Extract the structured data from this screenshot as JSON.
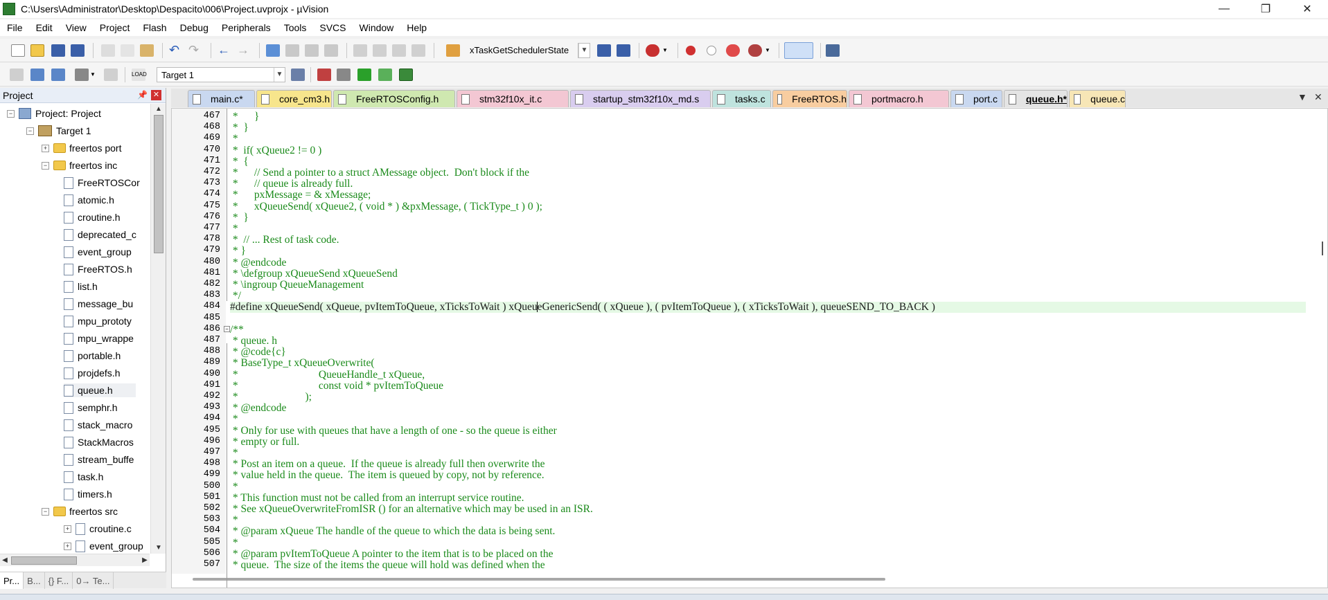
{
  "window": {
    "title": "C:\\Users\\Administrator\\Desktop\\Despacito\\006\\Project.uvprojx - µVision"
  },
  "menu": [
    "File",
    "Edit",
    "View",
    "Project",
    "Flash",
    "Debug",
    "Peripherals",
    "Tools",
    "SVCS",
    "Window",
    "Help"
  ],
  "toolbar": {
    "function_combo": "xTaskGetSchedulerState",
    "target_combo": "Target 1"
  },
  "project_panel": {
    "title": "Project",
    "tree": [
      {
        "label": "Project: Project",
        "level": 0,
        "kind": "project",
        "expanded": true
      },
      {
        "label": "Target 1",
        "level": 1,
        "kind": "target",
        "expanded": true
      },
      {
        "label": "freertos port",
        "level": 2,
        "kind": "folder",
        "expanded": false
      },
      {
        "label": "freertos inc",
        "level": 2,
        "kind": "folder",
        "expanded": true
      },
      {
        "label": "FreeRTOSCor",
        "level": 3,
        "kind": "file"
      },
      {
        "label": "atomic.h",
        "level": 3,
        "kind": "file"
      },
      {
        "label": "croutine.h",
        "level": 3,
        "kind": "file"
      },
      {
        "label": "deprecated_c",
        "level": 3,
        "kind": "file"
      },
      {
        "label": "event_group",
        "level": 3,
        "kind": "file"
      },
      {
        "label": "FreeRTOS.h",
        "level": 3,
        "kind": "file"
      },
      {
        "label": "list.h",
        "level": 3,
        "kind": "file"
      },
      {
        "label": "message_bu",
        "level": 3,
        "kind": "file"
      },
      {
        "label": "mpu_prototy",
        "level": 3,
        "kind": "file"
      },
      {
        "label": "mpu_wrappe",
        "level": 3,
        "kind": "file"
      },
      {
        "label": "portable.h",
        "level": 3,
        "kind": "file"
      },
      {
        "label": "projdefs.h",
        "level": 3,
        "kind": "file"
      },
      {
        "label": "queue.h",
        "level": 3,
        "kind": "file",
        "selected": true
      },
      {
        "label": "semphr.h",
        "level": 3,
        "kind": "file"
      },
      {
        "label": "stack_macro",
        "level": 3,
        "kind": "file"
      },
      {
        "label": "StackMacros",
        "level": 3,
        "kind": "file"
      },
      {
        "label": "stream_buffe",
        "level": 3,
        "kind": "file"
      },
      {
        "label": "task.h",
        "level": 3,
        "kind": "file"
      },
      {
        "label": "timers.h",
        "level": 3,
        "kind": "file"
      },
      {
        "label": "freertos src",
        "level": 2,
        "kind": "folder",
        "expanded": true
      },
      {
        "label": "croutine.c",
        "level": 3,
        "kind": "file-exp"
      },
      {
        "label": "event_group",
        "level": 3,
        "kind": "file-exp"
      }
    ],
    "bottom_tabs": [
      "Pr...",
      "B...",
      "{} F...",
      "0→ Te..."
    ]
  },
  "editor_tabs": [
    {
      "label": "main.c*",
      "color": "#c9d8f0"
    },
    {
      "label": "core_cm3.h",
      "color": "#f7e58c"
    },
    {
      "label": "FreeRTOSConfig.h",
      "color": "#cfe8b0"
    },
    {
      "label": "stm32f10x_it.c",
      "color": "#f3c7d3"
    },
    {
      "label": "startup_stm32f10x_md.s",
      "color": "#d9cdef"
    },
    {
      "label": "tasks.c",
      "color": "#bfe3de"
    },
    {
      "label": "FreeRTOS.h",
      "color": "#f8cda0"
    },
    {
      "label": "portmacro.h",
      "color": "#f3c7d3"
    },
    {
      "label": "port.c",
      "color": "#c9d8f0"
    },
    {
      "label": "queue.h*",
      "color": "#e4e4e4",
      "active": true
    },
    {
      "label": "queue.c",
      "color": "#f7e6b6"
    }
  ],
  "code": [
    {
      "n": "467",
      "t": " *      }"
    },
    {
      "n": "468",
      "t": " *  }"
    },
    {
      "n": "469",
      "t": " *"
    },
    {
      "n": "470",
      "t": " *  if( xQueue2 != 0 )"
    },
    {
      "n": "471",
      "t": " *  {"
    },
    {
      "n": "472",
      "t": " *      // Send a pointer to a struct AMessage object.  Don't block if the"
    },
    {
      "n": "473",
      "t": " *      // queue is already full."
    },
    {
      "n": "474",
      "t": " *      pxMessage = & xMessage;"
    },
    {
      "n": "475",
      "t": " *      xQueueSend( xQueue2, ( void * ) &pxMessage, ( TickType_t ) 0 );"
    },
    {
      "n": "476",
      "t": " *  }"
    },
    {
      "n": "477",
      "t": " *"
    },
    {
      "n": "478",
      "t": " *  // ... Rest of task code."
    },
    {
      "n": "479",
      "t": " * }"
    },
    {
      "n": "480",
      "t": " * @endcode"
    },
    {
      "n": "481",
      "t": " * \\defgroup xQueueSend xQueueSend"
    },
    {
      "n": "482",
      "t": " * \\ingroup QueueManagement"
    },
    {
      "n": "483",
      "t": " */"
    },
    {
      "n": "484",
      "t": "#define xQueueSend( xQueue, pvItemToQueue, xTicksToWait ) xQueueGenericSend( ( xQueue ), ( pvItemToQueue ), ( xTicksToWait ), queueSEND_TO_BACK )",
      "define": true
    },
    {
      "n": "485",
      "t": ""
    },
    {
      "n": "486",
      "t": "/**"
    },
    {
      "n": "487",
      "t": " * queue. h"
    },
    {
      "n": "488",
      "t": " * @code{c}"
    },
    {
      "n": "489",
      "t": " * BaseType_t xQueueOverwrite("
    },
    {
      "n": "490",
      "t": " *                              QueueHandle_t xQueue,"
    },
    {
      "n": "491",
      "t": " *                              const void * pvItemToQueue"
    },
    {
      "n": "492",
      "t": " *                         );"
    },
    {
      "n": "493",
      "t": " * @endcode"
    },
    {
      "n": "494",
      "t": " *"
    },
    {
      "n": "495",
      "t": " * Only for use with queues that have a length of one - so the queue is either"
    },
    {
      "n": "496",
      "t": " * empty or full."
    },
    {
      "n": "497",
      "t": " *"
    },
    {
      "n": "498",
      "t": " * Post an item on a queue.  If the queue is already full then overwrite the"
    },
    {
      "n": "499",
      "t": " * value held in the queue.  The item is queued by copy, not by reference."
    },
    {
      "n": "500",
      "t": " *"
    },
    {
      "n": "501",
      "t": " * This function must not be called from an interrupt service routine."
    },
    {
      "n": "502",
      "t": " * See xQueueOverwriteFromISR () for an alternative which may be used in an ISR."
    },
    {
      "n": "503",
      "t": " *"
    },
    {
      "n": "504",
      "t": " * @param xQueue The handle of the queue to which the data is being sent."
    },
    {
      "n": "505",
      "t": " *"
    },
    {
      "n": "506",
      "t": " * @param pvItemToQueue A pointer to the item that is to be placed on the"
    },
    {
      "n": "507",
      "t": " * queue.  The size of the items the queue will hold was defined when the"
    }
  ]
}
